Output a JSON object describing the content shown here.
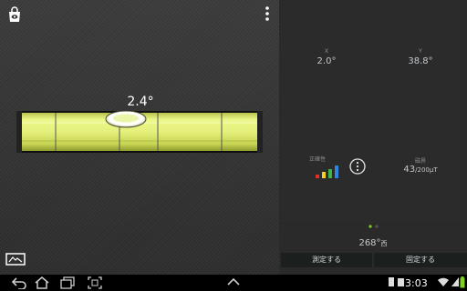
{
  "level": {
    "angle_text": "2.4°"
  },
  "readings": {
    "x_label": "X",
    "x_value": "2.0°",
    "y_label": "Y",
    "y_value": "38.8°",
    "accuracy_label": "正確性",
    "magnetic_label": "磁界",
    "magnetic_value": "43",
    "magnetic_unit": "/200μT"
  },
  "heading": {
    "value": "268°",
    "direction": "西"
  },
  "buttons": {
    "measure": "測定する",
    "fix": "固定する"
  },
  "status_bar": {
    "time": "3:03"
  },
  "colors": {
    "vial_green": "#e4f07a",
    "accent_green": "#7dd324",
    "accuracy_red": "#e0302a",
    "accuracy_yellow": "#f2d021",
    "accuracy_green": "#39b54a",
    "accuracy_blue": "#2f86e0"
  }
}
